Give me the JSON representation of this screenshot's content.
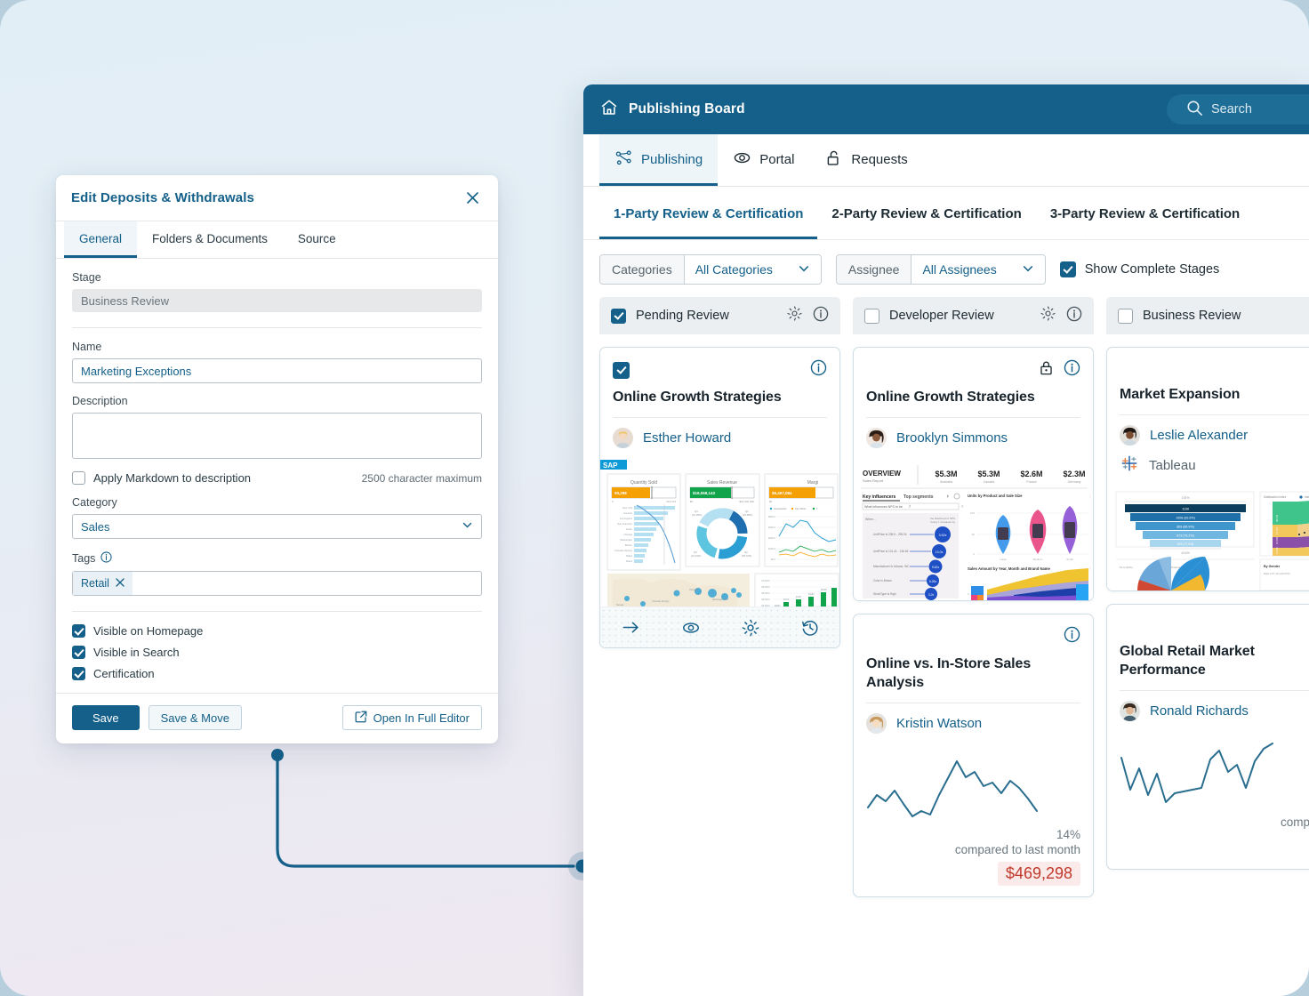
{
  "theme": {
    "accent": "#14608a",
    "surface": "#ffffff",
    "board_bg": "#eceff1",
    "negative": "#c0392b",
    "positive": "#1f8a4c"
  },
  "dialog": {
    "title": "Edit Deposits & Withdrawals",
    "close_label": "×",
    "tabs": [
      {
        "label": "General",
        "active": true
      },
      {
        "label": "Folders & Documents",
        "active": false
      },
      {
        "label": "Source",
        "active": false
      }
    ],
    "stage": {
      "label": "Stage",
      "value": "Business Review"
    },
    "name": {
      "label": "Name",
      "value": "Marketing Exceptions",
      "placeholder": "Name"
    },
    "description": {
      "label": "Description",
      "value": "",
      "placeholder": ""
    },
    "markdown": {
      "label": "Apply Markdown to description",
      "checked": false
    },
    "char_max": "2500 character maximum",
    "category": {
      "label": "Category",
      "value": "Sales"
    },
    "tags": {
      "label": "Tags",
      "chips": [
        {
          "label": "Retail"
        }
      ]
    },
    "toggles": [
      {
        "label": "Visible on Homepage",
        "checked": true
      },
      {
        "label": "Visible in Search",
        "checked": true
      },
      {
        "label": "Certification",
        "checked": true
      }
    ],
    "buttons": {
      "save": "Save",
      "save_move": "Save & Move",
      "open_editor": "Open In Full Editor"
    }
  },
  "app": {
    "header": {
      "title": "Publishing Board",
      "search_placeholder": "Search"
    },
    "nav_tabs": [
      {
        "label": "Publishing",
        "icon": "publishing-flow-icon",
        "active": true
      },
      {
        "label": "Portal",
        "icon": "eye-icon",
        "active": false
      },
      {
        "label": "Requests",
        "icon": "unlock-icon",
        "active": false
      }
    ],
    "sub_tabs": [
      {
        "label": "1-Party Review & Certification",
        "active": true
      },
      {
        "label": "2-Party Review & Certification",
        "active": false
      },
      {
        "label": "3-Party Review & Certification",
        "active": false
      }
    ],
    "filters": {
      "categories": {
        "key": "Categories",
        "value": "All Categories"
      },
      "assignee": {
        "key": "Assignee",
        "value": "All Assignees"
      },
      "show_complete": {
        "label": "Show Complete Stages",
        "checked": true
      }
    },
    "columns": [
      {
        "title": "Pending Review",
        "checked": true,
        "cards": [
          {
            "title": "Online Growth Strategies",
            "person": "Esther Howard",
            "selected": true,
            "locked": false,
            "thumb": "sap-dashboard",
            "footer_actions": [
              "arrow-right-icon",
              "eye-icon",
              "gear-icon",
              "history-icon"
            ]
          }
        ]
      },
      {
        "title": "Developer Review",
        "checked": false,
        "cards": [
          {
            "title": "Online Growth Strategies",
            "person": "Brooklyn Simmons",
            "selected": false,
            "locked": true,
            "thumb": "powerbi-dashboard",
            "thumb_labels": [
              "OVERVIEW",
              "Sales Report",
              "$5.3M",
              "Australia",
              "$5.3M",
              "Canada",
              "$2.6M",
              "France",
              "$2.3M",
              "Germany",
              "Key influencers",
              "Top segments",
              "Units by Product and Sale Size",
              "Sales Amount by Year, Month and Brand Name"
            ]
          },
          {
            "title": "Online vs. In-Store Sales Analysis",
            "person": "Kristin Watson",
            "selected": false,
            "locked": false,
            "thumb": "sparkline-down",
            "metric": {
              "pct": "14%",
              "compare": "compared to last month",
              "value": "$469,298",
              "direction": "negative"
            }
          }
        ]
      },
      {
        "title": "Business Review",
        "checked": false,
        "cards": [
          {
            "title": "Market Expansion",
            "person": "Leslie Alexander",
            "source": "Tableau",
            "selected": false,
            "locked": false,
            "thumb": "tableau-dashboard"
          },
          {
            "title": "Global Retail Market Performance",
            "person": "Ronald Richards",
            "selected": false,
            "locked": false,
            "thumb": "sparkline-up",
            "metric": {
              "pct": "",
              "compare": "compared",
              "value": "$",
              "direction": "positive"
            }
          }
        ]
      }
    ]
  }
}
